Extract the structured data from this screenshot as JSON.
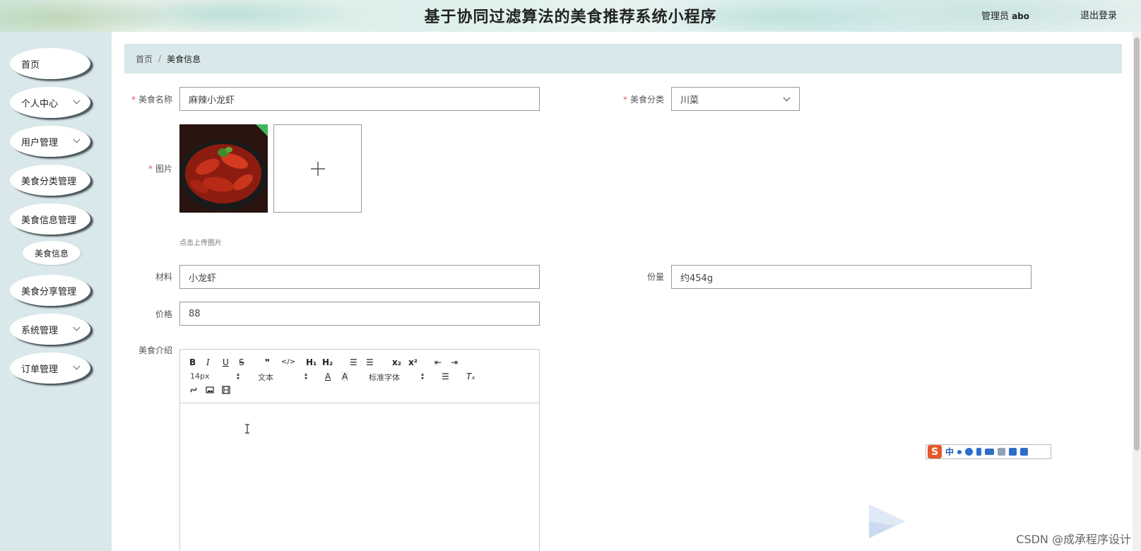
{
  "header": {
    "title": "基于协同过滤算法的美食推荐系统小程序",
    "user_role": "管理员",
    "user_name": "abo",
    "logout_label": "退出登录"
  },
  "sidebar": {
    "items": [
      {
        "label": "首页",
        "has_arrow": false
      },
      {
        "label": "个人中心",
        "has_arrow": true
      },
      {
        "label": "用户管理",
        "has_arrow": true
      },
      {
        "label": "美食分类管理",
        "has_arrow": true
      },
      {
        "label": "美食信息管理",
        "has_arrow": true
      },
      {
        "label": "美食分享管理",
        "has_arrow": true
      },
      {
        "label": "系统管理",
        "has_arrow": true
      },
      {
        "label": "订单管理",
        "has_arrow": true
      }
    ],
    "active_sub": "美食信息"
  },
  "breadcrumb": {
    "home": "首页",
    "separator": "/",
    "current": "美食信息"
  },
  "form": {
    "name_label": "美食名称",
    "name_value": "麻辣小龙虾",
    "category_label": "美食分类",
    "category_value": "川菜",
    "image_label": "图片",
    "upload_tip": "点击上传图片",
    "material_label": "材料",
    "material_value": "小龙虾",
    "portion_label": "份量",
    "portion_value": "约454g",
    "price_label": "价格",
    "price_value": "88",
    "intro_label": "美食介绍",
    "required_mark": "*"
  },
  "editor": {
    "buttons": {
      "bold": "B",
      "italic": "I",
      "underline": "U",
      "strike": "S",
      "quote": "❞",
      "code": "</>",
      "h1": "H₁",
      "h2": "H₂",
      "ol": "☰",
      "ul": "☰",
      "sub": "x₂",
      "sup": "x²",
      "outdent": "⇤",
      "indent": "⇥",
      "color": "A",
      "bg": "A",
      "align": "☰",
      "clear": "Tₓ"
    },
    "font_size": "14px",
    "header_select": "文本",
    "font_family": "标准字体"
  },
  "ime": {
    "label": "中"
  },
  "watermark": "CSDN @成承程序设计",
  "colors": {
    "sidebar_bg": "#d9e8ea",
    "breadcrumb_bg": "#d9e8ea",
    "required": "#e05a5a",
    "ime_logo": "#e8572a"
  }
}
